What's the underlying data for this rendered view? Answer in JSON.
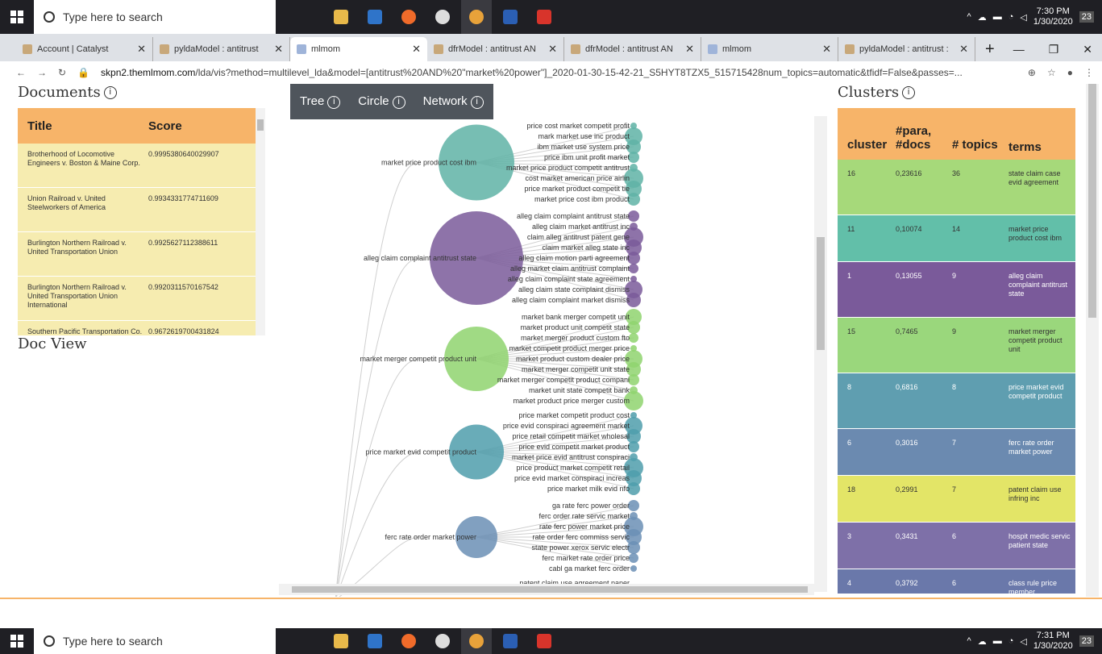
{
  "taskbar_top": {
    "search_placeholder": "Type here to search",
    "time": "7:30 PM",
    "date": "1/30/2020",
    "notif_count": "23",
    "apps": [
      "file-explorer",
      "outlook",
      "firefox",
      "settings",
      "chrome",
      "word",
      "acrobat"
    ]
  },
  "taskbar_bottom": {
    "search_placeholder": "Type here to search",
    "time": "7:31 PM",
    "date": "1/30/2020",
    "notif_count": "23"
  },
  "browser": {
    "tabs": [
      {
        "title": "Account | Catalyst",
        "active": false
      },
      {
        "title": "pyldaModel : antitrust",
        "active": false
      },
      {
        "title": "mlmom",
        "active": true
      },
      {
        "title": "dfrModel : antitrust AN",
        "active": false
      },
      {
        "title": "dfrModel : antitrust AN",
        "active": false
      },
      {
        "title": "mlmom",
        "active": false
      },
      {
        "title": "pyldaModel : antitrust :",
        "active": false
      }
    ],
    "url_host": "skpn2.themlmom.com",
    "url_rest": "/lda/vis?method=multilevel_lda&model=[antitrust%20AND%20\"market%20power\"]_2020-01-30-15-42-21_S5HYT8TZX5_515715428num_topics=automatic&tfidf=False&passes=..."
  },
  "documents": {
    "title": "Documents",
    "col_title": "Title",
    "col_score": "Score",
    "rows": [
      {
        "title": "Brotherhood of Locomotive Engineers v. Boston & Maine Corp.",
        "score": "0.9995380640029907"
      },
      {
        "title": "Union Railroad v. United Steelworkers of America",
        "score": "0.9934331774711609"
      },
      {
        "title": "Burlington Northern Railroad v. United Transportation Union",
        "score": "0.9925627112388611"
      },
      {
        "title": "Burlington Northern Railroad v. United Transportation Union International",
        "score": "0.9920311570167542"
      },
      {
        "title": "Southern Pacific Transportation Co. v. International Brotherhood",
        "score": "0.9672619700431824"
      }
    ]
  },
  "doc_view": {
    "title": "Doc View"
  },
  "viz": {
    "tab_tree": "Tree",
    "tab_circle": "Circle",
    "tab_network": "Network",
    "groups": [
      {
        "label": "market price product cost ibm",
        "color": "#5fb3a6",
        "children": [
          "price cost market competit profit",
          "mark market use inc product",
          "ibm market use system price",
          "price ibm unit profit market",
          "market price product competit antitrust",
          "cost market american price airlin",
          "price market product competit tie",
          "market price cost ibm product"
        ]
      },
      {
        "label": "alleg claim complaint antitrust state",
        "color": "#7a5a9a",
        "children": [
          "alleg claim complaint antitrust state",
          "alleg claim market antitrust inc",
          "claim alleg antitrust patent gene",
          "claim market alleg state inc",
          "alleg claim motion parti agreement",
          "alleg market claim antitrust complaint",
          "alleg claim complaint state agreement",
          "alleg claim state complaint dismiss",
          "alleg claim complaint market dismiss"
        ]
      },
      {
        "label": "market merger competit product unit",
        "color": "#8fd46e",
        "children": [
          "market bank merger competit unit",
          "market product unit competit state",
          "market merger product custom fto",
          "market competit product merger price",
          "market product custom dealer price",
          "market merger competit unit state",
          "market merger competit product compani",
          "market unit state competit bank",
          "market product price merger custom"
        ]
      },
      {
        "label": "price market evid competit product",
        "color": "#4f9eab",
        "children": [
          "price market competit product cost",
          "price evid conspiraci agreement market",
          "price retail competit market wholesal",
          "price evid competit market product",
          "market price evid antitrust conspiraci",
          "price product market competit retail",
          "price evid market conspiraci increas",
          "price market milk evid nfo"
        ]
      },
      {
        "label": "ferc rate order market power",
        "color": "#6b8fb5",
        "children": [
          "ga rate ferc power order",
          "ferc order rate servic market",
          "rate ferc power market price",
          "rate order ferc commiss servic",
          "state power xerox servic electr",
          "ferc market rate order price",
          "cabl ga market ferc order"
        ]
      }
    ],
    "partial_label": "patent claim use agreement paper"
  },
  "clusters": {
    "title": "Clusters",
    "col_cluster": "cluster",
    "col_para": "#para, #docs",
    "col_topics": "# topics",
    "col_terms": "terms",
    "rows": [
      {
        "cluster": "16",
        "para": "0,23616",
        "topics": "36",
        "terms": "state claim case evid agreement",
        "color": "#a6d97a",
        "light": true
      },
      {
        "cluster": "11",
        "para": "0,10074",
        "topics": "14",
        "terms": "market price product cost ibm",
        "color": "#62bfa9",
        "light": true
      },
      {
        "cluster": "1",
        "para": "0,13055",
        "topics": "9",
        "terms": "alleg claim complaint antitrust state",
        "color": "#7a5a9a",
        "light": false
      },
      {
        "cluster": "15",
        "para": "0,7465",
        "topics": "9",
        "terms": "market merger competit product unit",
        "color": "#9ad77c",
        "light": true
      },
      {
        "cluster": "8",
        "para": "0,6816",
        "topics": "8",
        "terms": "price market evid competit product",
        "color": "#5f9eb0",
        "light": false
      },
      {
        "cluster": "6",
        "para": "0,3016",
        "topics": "7",
        "terms": "ferc rate order market power",
        "color": "#6b8ab0",
        "light": false
      },
      {
        "cluster": "18",
        "para": "0,2991",
        "topics": "7",
        "terms": "patent claim use infring inc",
        "color": "#e3e567",
        "light": true
      },
      {
        "cluster": "3",
        "para": "0,3431",
        "topics": "6",
        "terms": "hospit medic servic patient state",
        "color": "#7e70a8",
        "light": false
      },
      {
        "cluster": "4",
        "para": "0,3792",
        "topics": "6",
        "terms": "class rule price member",
        "color": "#6a78aa",
        "light": false
      }
    ]
  }
}
